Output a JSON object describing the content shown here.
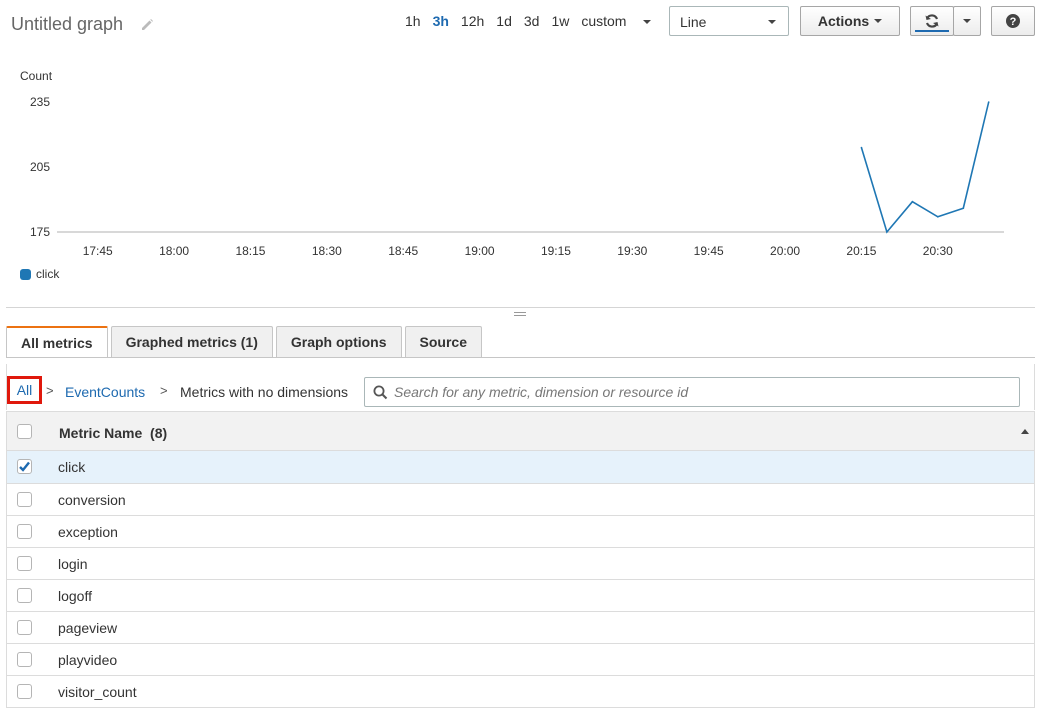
{
  "header": {
    "title": "Untitled graph",
    "time_ranges": [
      "1h",
      "3h",
      "12h",
      "1d",
      "3d",
      "1w"
    ],
    "active_range": "3h",
    "custom_label": "custom",
    "graph_type": "Line",
    "actions_label": "Actions"
  },
  "chart_data": {
    "type": "line",
    "ylabel": "Count",
    "yticks": [
      175,
      205,
      235
    ],
    "ylim": [
      175,
      235
    ],
    "xticks": [
      "17:45",
      "18:00",
      "18:15",
      "18:30",
      "18:45",
      "19:00",
      "19:15",
      "19:30",
      "19:45",
      "20:00",
      "20:15",
      "20:30"
    ],
    "series": [
      {
        "name": "click",
        "color": "#1f77b4",
        "x": [
          "20:15",
          "20:20",
          "20:25",
          "20:30",
          "20:35",
          "20:40"
        ],
        "values": [
          214,
          175,
          189,
          182,
          186,
          235
        ]
      }
    ],
    "legend_position": "bottom-left"
  },
  "tabs": [
    "All metrics",
    "Graphed metrics (1)",
    "Graph options",
    "Source"
  ],
  "active_tab": "All metrics",
  "breadcrumb": {
    "all": "All",
    "namespace": "EventCounts",
    "current": "Metrics with no dimensions",
    "separator": ">"
  },
  "search": {
    "placeholder": "Search for any metric, dimension or resource id",
    "value": ""
  },
  "table": {
    "header": "Metric Name",
    "count": "(8)",
    "rows": [
      {
        "name": "click",
        "checked": true
      },
      {
        "name": "conversion",
        "checked": false
      },
      {
        "name": "exception",
        "checked": false
      },
      {
        "name": "login",
        "checked": false
      },
      {
        "name": "logoff",
        "checked": false
      },
      {
        "name": "pageview",
        "checked": false
      },
      {
        "name": "playvideo",
        "checked": false
      },
      {
        "name": "visitor_count",
        "checked": false
      }
    ]
  },
  "colors": {
    "accent": "#1e6ab0",
    "tab_highlight": "#ec7211",
    "highlight_box": "#e0180c",
    "line": "#1f77b4"
  }
}
